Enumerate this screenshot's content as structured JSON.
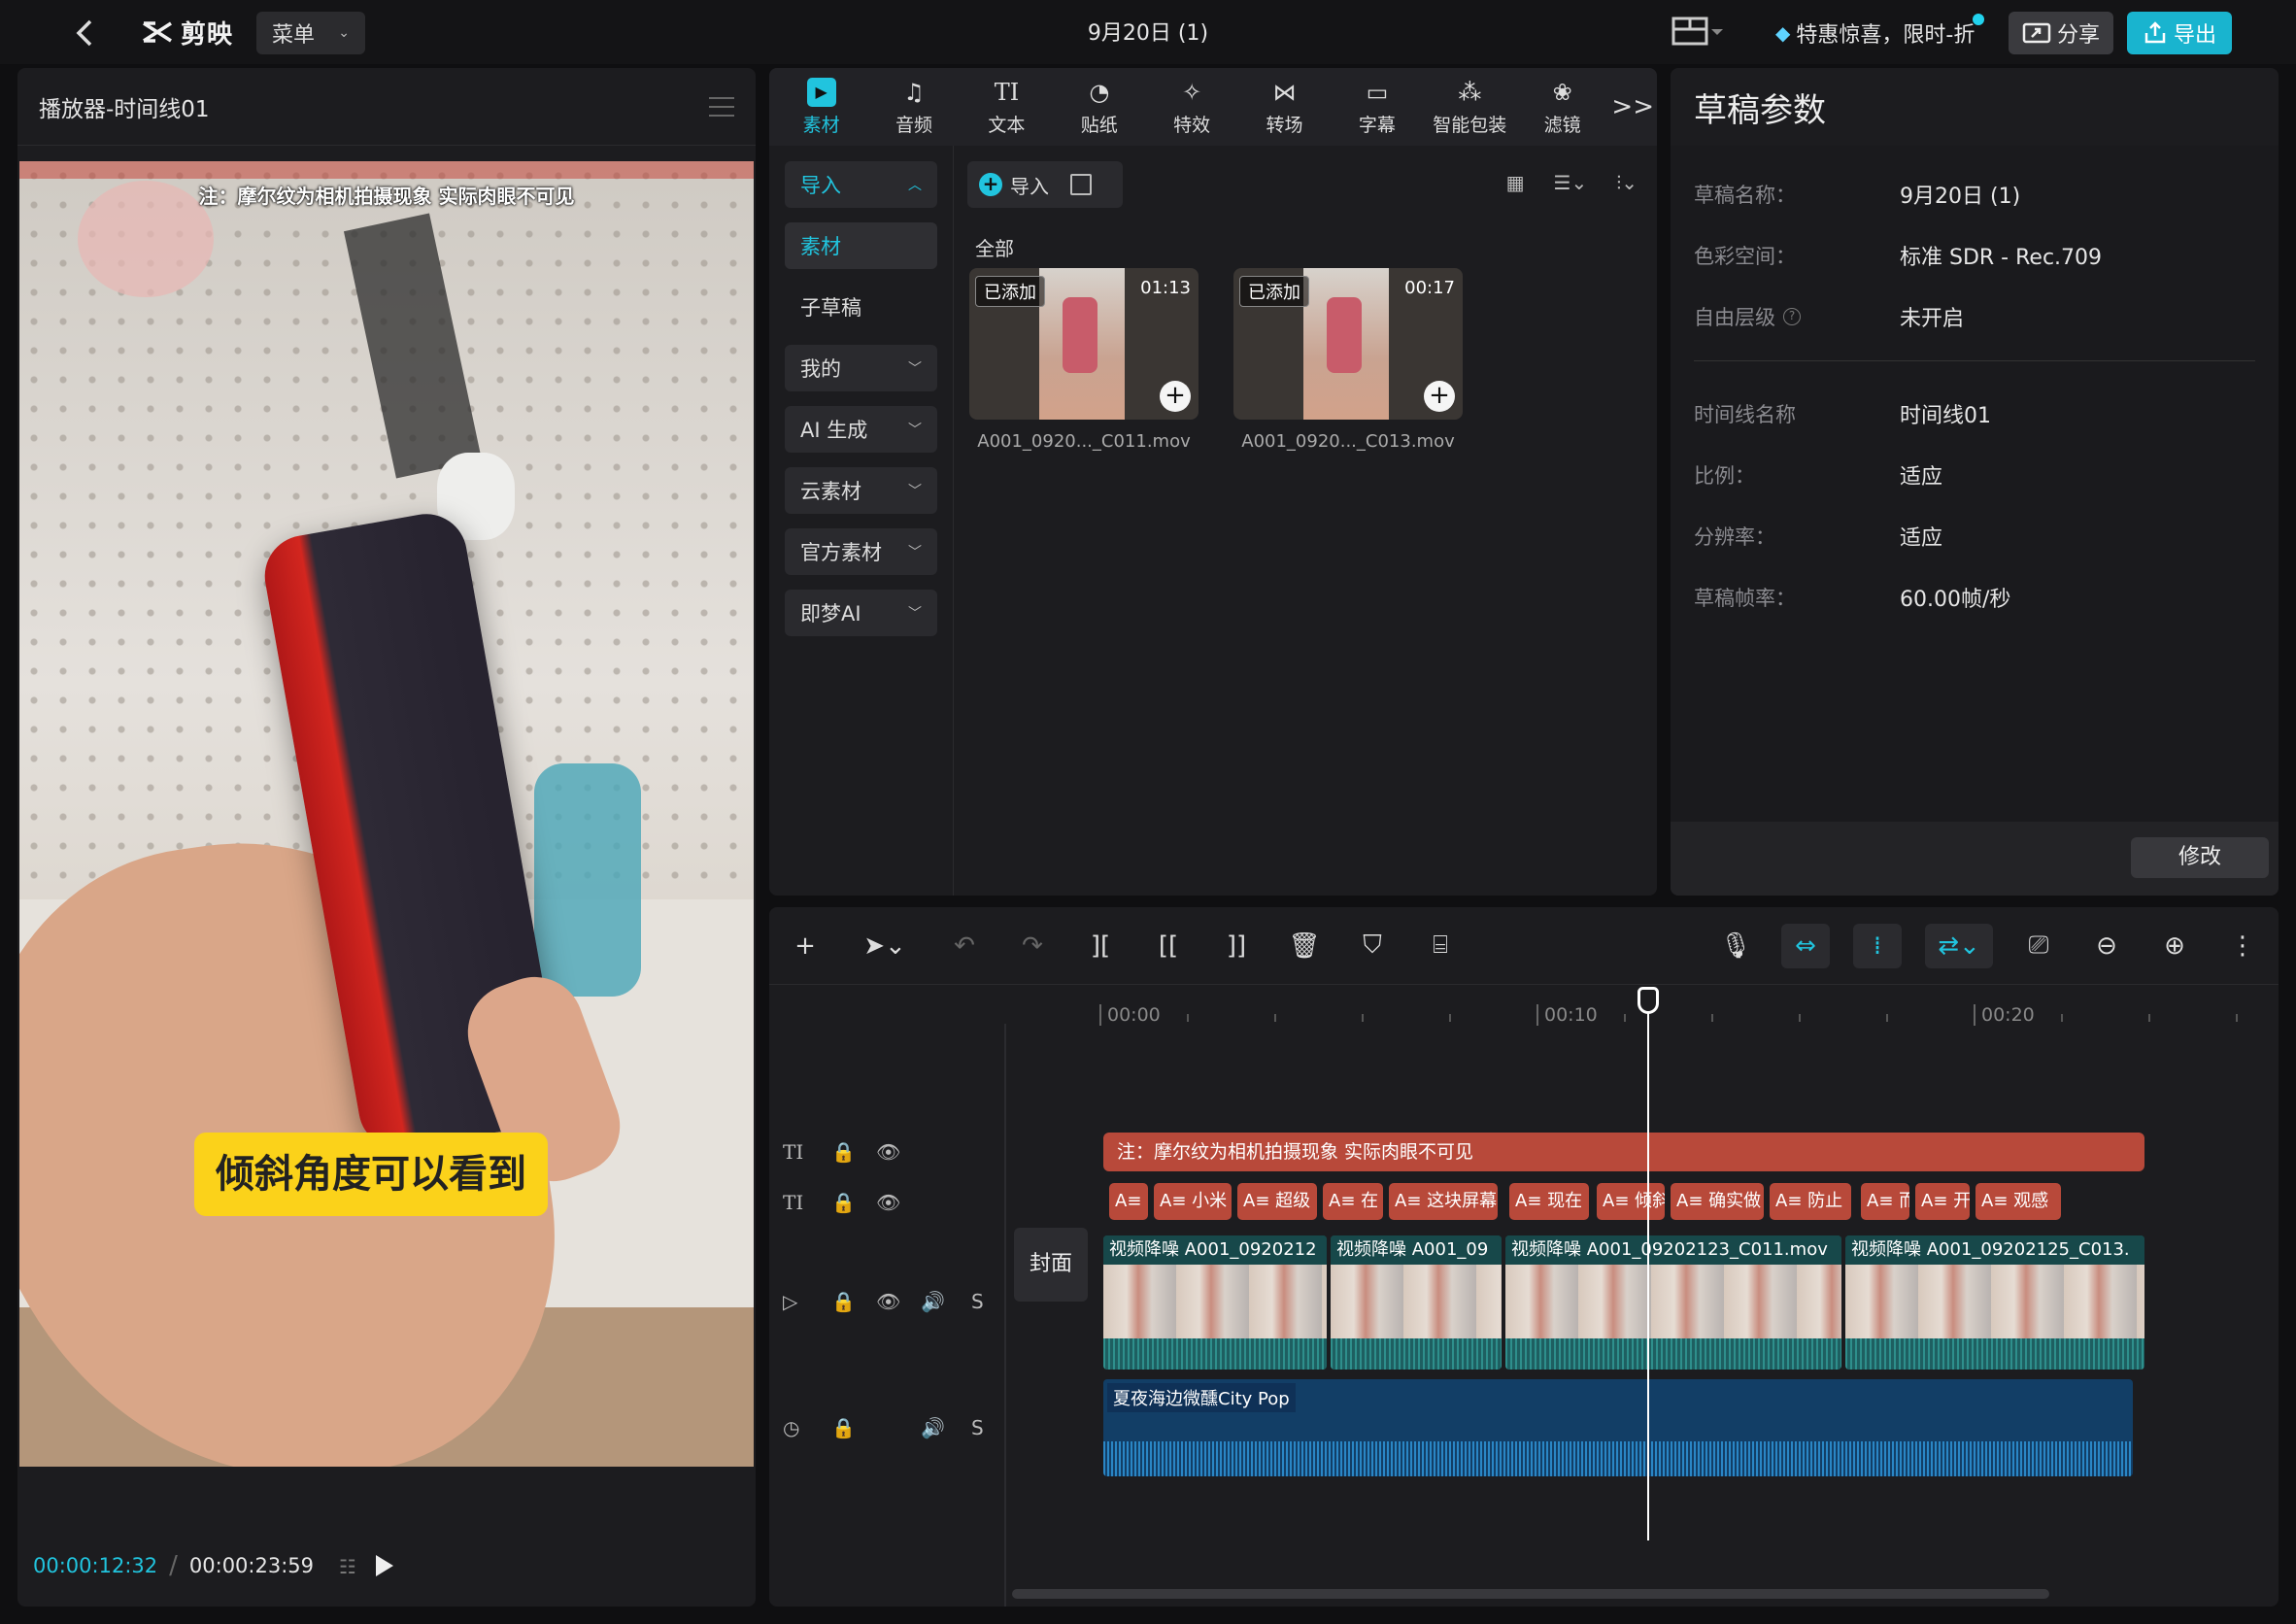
{
  "topbar": {
    "logo_text": "剪映",
    "menu_label": "菜单",
    "doc_title": "9月20日 (1)",
    "promo_text": "特惠惊喜，限时-折",
    "share_label": "分享",
    "export_label": "导出"
  },
  "player": {
    "title": "播放器-时间线01",
    "overlay_note": "注：摩尔纹为相机拍摄现象 实际肉眼不可见",
    "subtitle": "倾斜角度可以看到",
    "current_time": "00:00:12:32",
    "separator": "/",
    "total_time": "00:00:23:59"
  },
  "media": {
    "tabs": [
      {
        "label": "素材",
        "icon": "media-icon"
      },
      {
        "label": "音频",
        "icon": "audio-icon"
      },
      {
        "label": "文本",
        "icon": "text-icon",
        "glyph": "TI"
      },
      {
        "label": "贴纸",
        "icon": "sticker-icon"
      },
      {
        "label": "特效",
        "icon": "effects-icon"
      },
      {
        "label": "转场",
        "icon": "transition-icon"
      },
      {
        "label": "字幕",
        "icon": "caption-icon"
      },
      {
        "label": "智能包装",
        "icon": "smart-package-icon"
      },
      {
        "label": "滤镜",
        "icon": "filter-icon"
      }
    ],
    "more_label": ">>",
    "sidebar": [
      {
        "label": "导入"
      },
      {
        "label": "素材"
      },
      {
        "label": "子草稿"
      },
      {
        "label": "我的"
      },
      {
        "label": "AI 生成"
      },
      {
        "label": "云素材"
      },
      {
        "label": "官方素材"
      },
      {
        "label": "即梦AI"
      }
    ],
    "import_label": "导入",
    "section_label": "全部",
    "clips": [
      {
        "badge": "已添加",
        "duration": "01:13",
        "name": "A001_0920..._C011.mov"
      },
      {
        "badge": "已添加",
        "duration": "00:17",
        "name": "A001_0920..._C013.mov"
      }
    ]
  },
  "draft": {
    "title": "草稿参数",
    "rows1": [
      {
        "label": "草稿名称：",
        "value": "9月20日 (1)"
      },
      {
        "label": "色彩空间：",
        "value": "标准 SDR - Rec.709"
      },
      {
        "label": "自由层级",
        "value": "未开启"
      }
    ],
    "rows2": [
      {
        "label": "时间线名称",
        "value": "时间线01"
      },
      {
        "label": "比例：",
        "value": "适应"
      },
      {
        "label": "分辨率：",
        "value": "适应"
      },
      {
        "label": "草稿帧率：",
        "value": "60.00帧/秒"
      }
    ],
    "modify_label": "修改"
  },
  "timeline": {
    "ruler": [
      "00:00",
      "00:10",
      "00:20"
    ],
    "track_text_glyph": "TI",
    "solo_label": "S",
    "text_bar": "注：摩尔纹为相机拍摄现象 实际肉眼不可见",
    "chips": [
      "A≡ ",
      "A≡ 小米",
      "A≡ 超级",
      "A≡ 在",
      "A≡ 这块屏幕",
      "A≡ 现在",
      "A≡ 倾斜",
      "A≡ 确实做",
      "A≡ 防止",
      "A≡ 而",
      "A≡ 开",
      "A≡ 观感"
    ],
    "cover_label": "封面",
    "video_clips": [
      {
        "label": "视频降噪  A001_0920212"
      },
      {
        "label": "视频降噪  A001_09"
      },
      {
        "label": "视频降噪  A001_09202123_C011.mov"
      },
      {
        "label": "视频降噪  A001_09202125_C013."
      }
    ],
    "audio_label": "夏夜海边微醺City Pop"
  }
}
